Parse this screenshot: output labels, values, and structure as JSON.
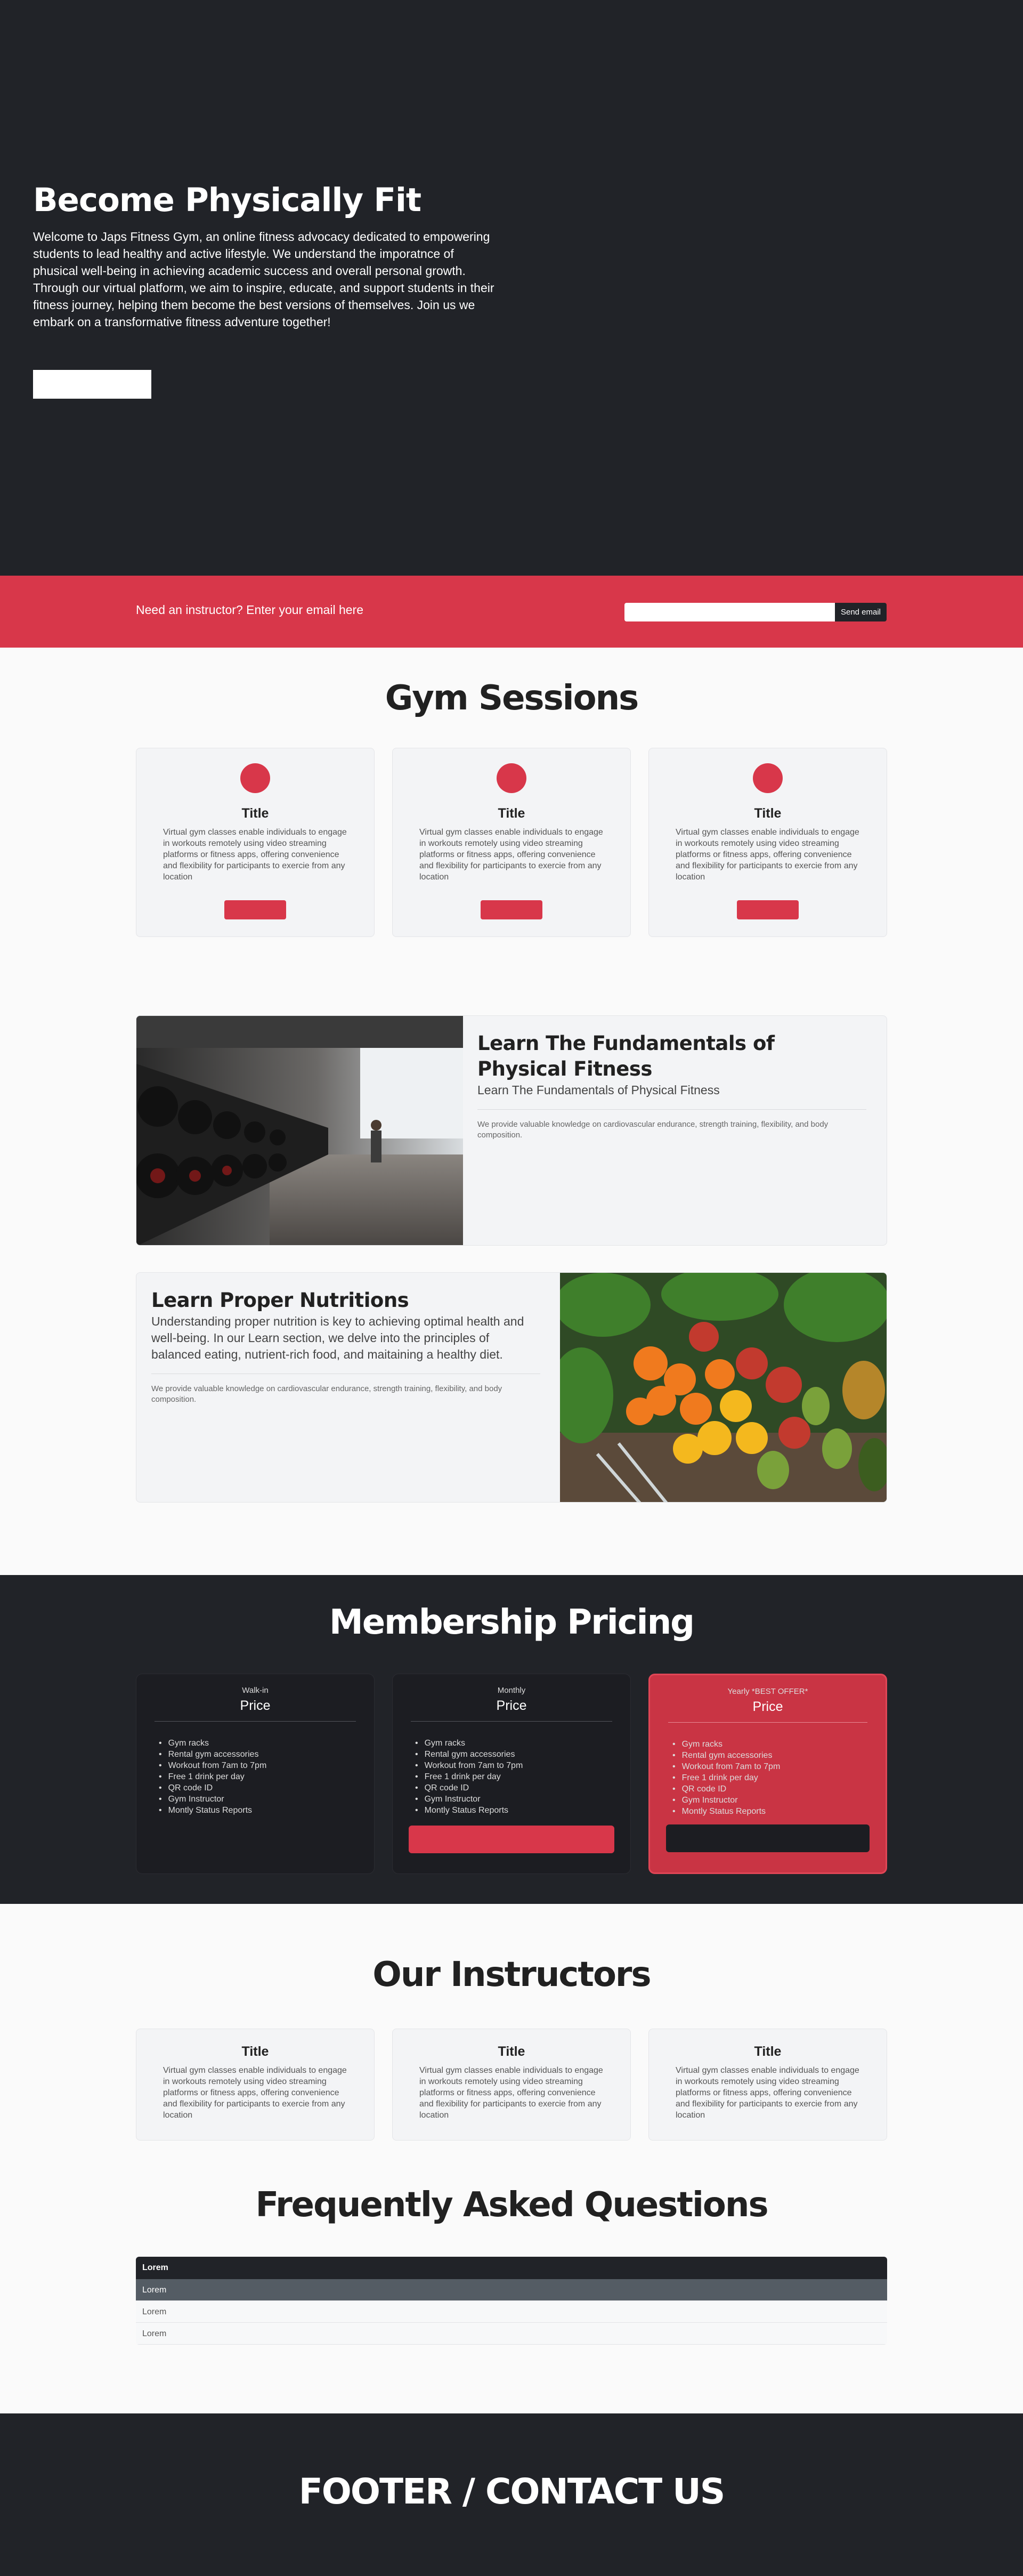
{
  "hero": {
    "title": "Become Physically Fit",
    "text": "Welcome to Japs Fitness Gym, an online fitness advocacy dedicated to empowering students to lead healthy and active lifestyle. We understand the imporatnce of phusical well-being in achieving academic success and overall personal growth. Through our virtual platform, we aim to inspire, educate, and support students in their fitness journey, helping them become the best versions of themselves. Join us we embark on a transformative fitness adventure together!"
  },
  "signup": {
    "prompt": "Need an instructor? Enter your email here",
    "button": "Send email",
    "placeholder": ""
  },
  "sessions": {
    "title": "Gym Sessions",
    "cards": [
      {
        "title": "Title",
        "text": "Virtual gym classes enable individuals to engage in workouts remotely using video streaming platforms or fitness apps, offering convenience and flexibility for participants to exercie from any location"
      },
      {
        "title": "Title",
        "text": "Virtual gym classes enable individuals to engage in workouts remotely using video streaming platforms or fitness apps, offering convenience and flexibility for participants to exercie from any location"
      },
      {
        "title": "Title",
        "text": "Virtual gym classes enable individuals to engage in workouts remotely using video streaming platforms or fitness apps, offering convenience and flexibility for participants to exercie from any location"
      }
    ]
  },
  "features": [
    {
      "title": "Learn The Fundamentals of Physical Fitness",
      "subtitle": "Learn The Fundamentals of Physical Fitness",
      "note": "We provide valuable knowledge on cardiovascular endurance, strength training, flexibility, and body composition."
    },
    {
      "title": "Learn Proper Nutritions",
      "subtitle": "Understanding proper nutrition is key to achieving optimal health and well-being. In our Learn section, we delve into the principles of balanced eating, nutrient-rich food, and maitaining a healthy diet.",
      "note": "We provide valuable knowledge on cardiovascular endurance, strength training, flexibility, and body composition."
    }
  ],
  "pricing": {
    "title": "Membership Pricing",
    "plans": [
      {
        "name": "Walk-in",
        "price": "Price",
        "items": [
          "Gym racks",
          "Rental gym accessories",
          "Workout from 7am to 7pm",
          "Free 1 drink per day",
          "QR code ID",
          "Gym Instructor",
          "Montly Status Reports"
        ]
      },
      {
        "name": "Monthly",
        "price": "Price",
        "items": [
          "Gym racks",
          "Rental gym accessories",
          "Workout from 7am to 7pm",
          "Free 1 drink per day",
          "QR code ID",
          "Gym Instructor",
          "Montly Status Reports"
        ]
      },
      {
        "name": "Yearly *BEST OFFER*",
        "price": "Price",
        "items": [
          "Gym racks",
          "Rental gym accessories",
          "Workout from 7am to 7pm",
          "Free 1 drink per day",
          "QR code ID",
          "Gym Instructor",
          "Montly Status Reports"
        ]
      }
    ],
    "colors": {
      "accent": "#d8374a",
      "best": "#c93444",
      "dark": "#212328"
    }
  },
  "instructors": {
    "title": "Our Instructors",
    "cards": [
      {
        "title": "Title",
        "text": "Virtual gym classes enable individuals to engage in workouts remotely using video streaming platforms or fitness apps, offering convenience and flexibility for participants to exercie from any location"
      },
      {
        "title": "Title",
        "text": "Virtual gym classes enable individuals to engage in workouts remotely using video streaming platforms or fitness apps, offering convenience and flexibility for participants to exercie from any location"
      },
      {
        "title": "Title",
        "text": "Virtual gym classes enable individuals to engage in workouts remotely using video streaming platforms or fitness apps, offering convenience and flexibility for participants to exercie from any location"
      }
    ]
  },
  "faq": {
    "title": "Frequently Asked Questions",
    "header": "Lorem",
    "rows": [
      "Lorem",
      "Lorem",
      "Lorem"
    ]
  },
  "footer": {
    "title": "FOOTER / CONTACT US"
  }
}
